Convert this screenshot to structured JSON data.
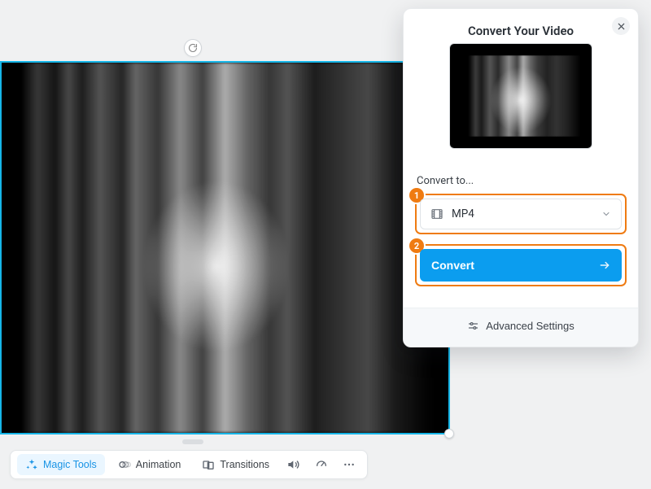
{
  "canvas": {
    "rotate_handle_title": "Rotate"
  },
  "toolbar": {
    "magic_tools_label": "Magic Tools",
    "animation_label": "Animation",
    "transitions_label": "Transitions"
  },
  "panel": {
    "title": "Convert Your Video",
    "convert_to_label": "Convert to...",
    "format_selected": "MP4",
    "convert_button_label": "Convert",
    "advanced_settings_label": "Advanced Settings",
    "step1_badge": "1",
    "step2_badge": "2"
  }
}
